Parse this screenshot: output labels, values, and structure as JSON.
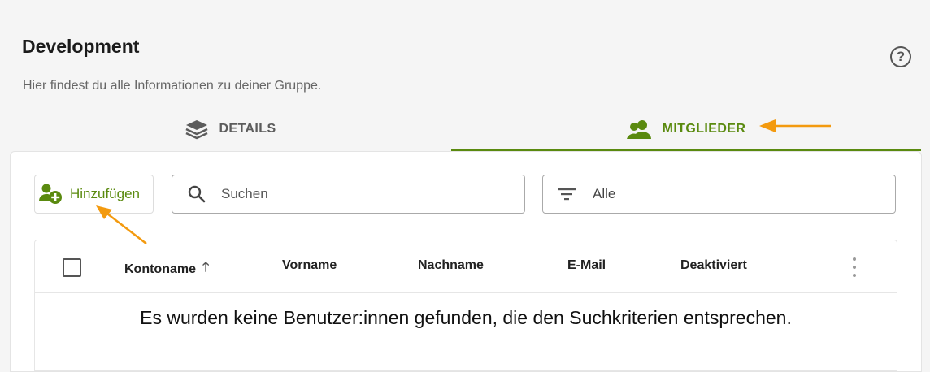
{
  "page": {
    "title": "Development",
    "subtitle": "Hier findest du alle Informationen zu deiner Gruppe.",
    "help_icon": "help-circle-icon"
  },
  "tabs": [
    {
      "label": "DETAILS",
      "icon": "layers-icon",
      "active": false
    },
    {
      "label": "MITGLIEDER",
      "icon": "users-icon",
      "active": true
    }
  ],
  "toolbar": {
    "add_label": "Hinzufügen",
    "search_placeholder": "Suchen",
    "filter_value": "Alle"
  },
  "table": {
    "columns": [
      "Kontoname",
      "Vorname",
      "Nachname",
      "E-Mail",
      "Deaktiviert"
    ],
    "sort_column": "Kontoname",
    "sort_direction": "ascending",
    "empty_message": "Es wurden keine Benutzer:innen gefunden, die den Suchkriterien entsprechen."
  },
  "colors": {
    "accent": "#5a8a0f",
    "annotation_arrow": "#f39a0f"
  }
}
